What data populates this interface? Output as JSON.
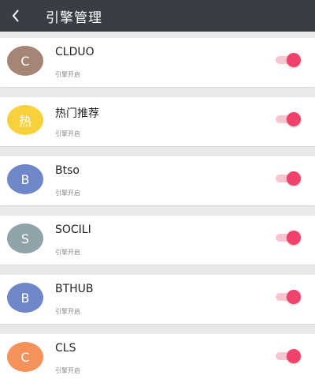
{
  "header": {
    "title": "引擎管理",
    "back_icon": "chevron-left-icon"
  },
  "colors": {
    "header_bg": "#3a3e44",
    "toggle_on": "#f0426a",
    "toggle_track": "#f7c6d0"
  },
  "engines": [
    {
      "name": "CLDUO",
      "initial": "C",
      "avatar_color": "#a58676",
      "status": "引擎开启",
      "enabled": true
    },
    {
      "name": "热门推荐",
      "initial": "热",
      "avatar_color": "#f7d23c",
      "status": "引擎开启",
      "enabled": true
    },
    {
      "name": "Btso",
      "initial": "B",
      "avatar_color": "#6f86c9",
      "status": "引擎开启",
      "enabled": true
    },
    {
      "name": "SOCILI",
      "initial": "S",
      "avatar_color": "#8fa3a9",
      "status": "引擎开启",
      "enabled": true
    },
    {
      "name": "BTHUB",
      "initial": "B",
      "avatar_color": "#6f86c9",
      "status": "引擎开启",
      "enabled": true
    },
    {
      "name": "CLS",
      "initial": "C",
      "avatar_color": "#f5915a",
      "status": "引擎开启",
      "enabled": true
    }
  ]
}
